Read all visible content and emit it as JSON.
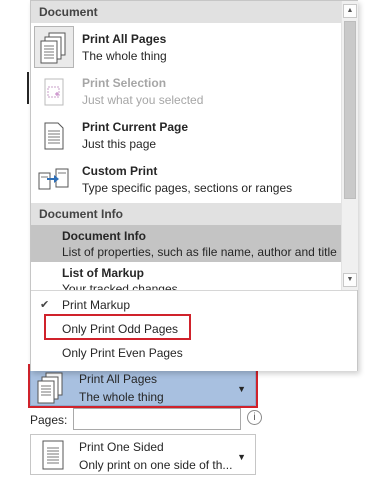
{
  "dropdown": {
    "sections": {
      "document": "Document",
      "document_info": "Document Info"
    },
    "items": [
      {
        "title": "Print All Pages",
        "desc": "The whole thing",
        "icon": "all-pages-icon"
      },
      {
        "title": "Print Selection",
        "desc": "Just what you selected",
        "icon": "selection-icon"
      },
      {
        "title": "Print Current Page",
        "desc": "Just this page",
        "icon": "current-page-icon"
      },
      {
        "title": "Custom Print",
        "desc": "Type specific pages, sections or ranges",
        "icon": "custom-print-icon"
      }
    ],
    "info_items": [
      {
        "title": "Document Info",
        "desc": "List of properties, such as file name, author and title"
      },
      {
        "title": "List of Markup",
        "desc": "Your tracked changes"
      }
    ],
    "options": [
      {
        "label": "Print Markup",
        "checked": true
      },
      {
        "label": "Only Print Odd Pages",
        "checked": false
      },
      {
        "label": "Only Print Even Pages",
        "checked": false
      }
    ]
  },
  "settings": {
    "pages_scope": {
      "title": "Print All Pages",
      "desc": "The whole thing"
    },
    "pages_label": "Pages:",
    "sides": {
      "title": "Print One Sided",
      "desc": "Only print on one side of th..."
    }
  },
  "colors": {
    "highlight": "#d0222b",
    "selected_setting": "#a8c0e0"
  }
}
